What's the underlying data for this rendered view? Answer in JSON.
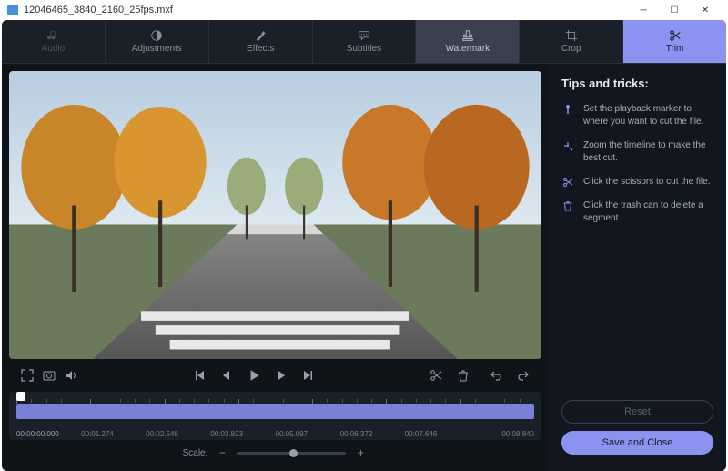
{
  "titlebar": {
    "filename": "12046465_3840_2160_25fps.mxf"
  },
  "tabs": {
    "audio": "Audio",
    "adjustments": "Adjustments",
    "effects": "Effects",
    "subtitles": "Subtitles",
    "watermark": "Watermark",
    "crop": "Crop",
    "trim": "Trim"
  },
  "timeline": {
    "labels": [
      "00:00:00.000",
      "00:01.274",
      "00:02.548",
      "00:03.823",
      "00:05.097",
      "00:06.372",
      "00:07.646",
      "00:08.840"
    ]
  },
  "scale": {
    "label": "Scale:"
  },
  "tips": {
    "title": "Tips and tricks:",
    "items": [
      "Set the playback marker to where you want to cut the file.",
      "Zoom the timeline to make the best cut.",
      "Click the scissors to cut the file.",
      "Click the trash can to delete a segment."
    ]
  },
  "buttons": {
    "reset": "Reset",
    "save": "Save and Close"
  }
}
